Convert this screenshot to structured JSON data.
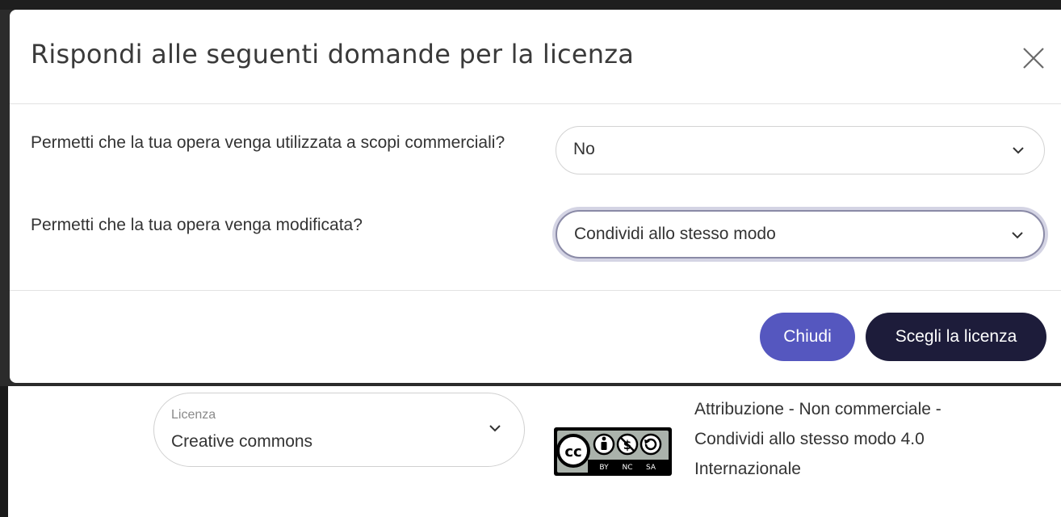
{
  "modal": {
    "title": "Rispondi alle seguenti domande per la licenza",
    "questions": [
      {
        "label": "Permetti che la tua opera venga utilizzata a scopi commerciali?",
        "selected": "No"
      },
      {
        "label": "Permetti che la tua opera venga modificata?",
        "selected": "Condividi allo stesso modo"
      }
    ],
    "buttons": {
      "close_label": "Chiudi",
      "choose_label": "Scegli la licenza"
    }
  },
  "license": {
    "select_label": "Licenza",
    "select_value": "Creative commons",
    "badge_icon": "cc-by-nc-sa-icon",
    "badge_tags": [
      "BY",
      "NC",
      "SA"
    ],
    "description": "Attribuzione - Non commerciale - Condividi allo stesso modo 4.0 Internazionale"
  },
  "colors": {
    "primary_button": "#5557bf",
    "dark_button": "#1d1c3a"
  }
}
